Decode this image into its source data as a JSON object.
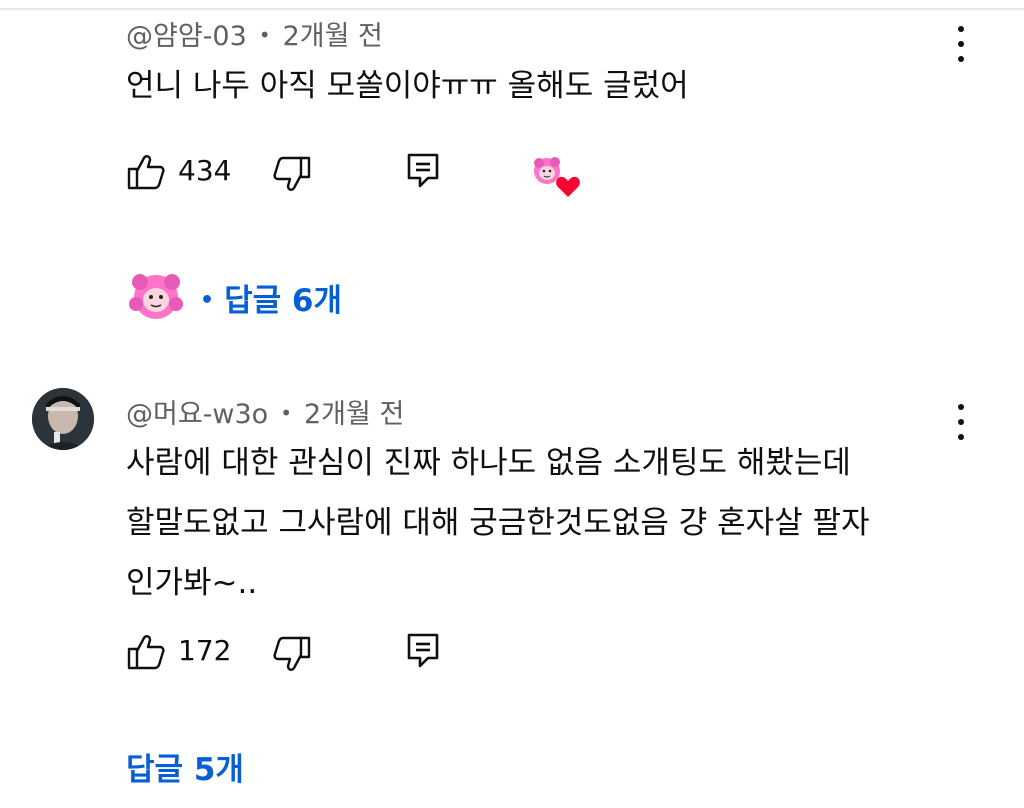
{
  "comments": [
    {
      "author": "@얌얌-03",
      "time": "2개월 전",
      "lines": [
        "언니 나두 아직 모쏠이야ㅠㅠ 올해도 글렀어"
      ],
      "likes": "434",
      "replies_label": "답글 6개",
      "creator_hearted": true
    },
    {
      "author": "@머요-w3o",
      "time": "2개월 전",
      "lines": [
        "사람에 대한 관심이 진짜 하나도 없음 소개팅도 해봤는데",
        "할말도없고 그사람에 대해 궁금한것도없음 걍 혼자살 팔자",
        "인가봐~.."
      ],
      "likes": "172",
      "replies_label": "답글 5개",
      "creator_hearted": false
    }
  ],
  "separator": "•",
  "icons": {
    "like": "thumbs-up-icon",
    "dislike": "thumbs-down-icon",
    "reply": "reply-comment-icon",
    "more": "more-vertical-icon",
    "heart": "heart-icon"
  },
  "colors": {
    "link": "#065fd4",
    "meta": "#606060",
    "heart": "#ff0033"
  }
}
